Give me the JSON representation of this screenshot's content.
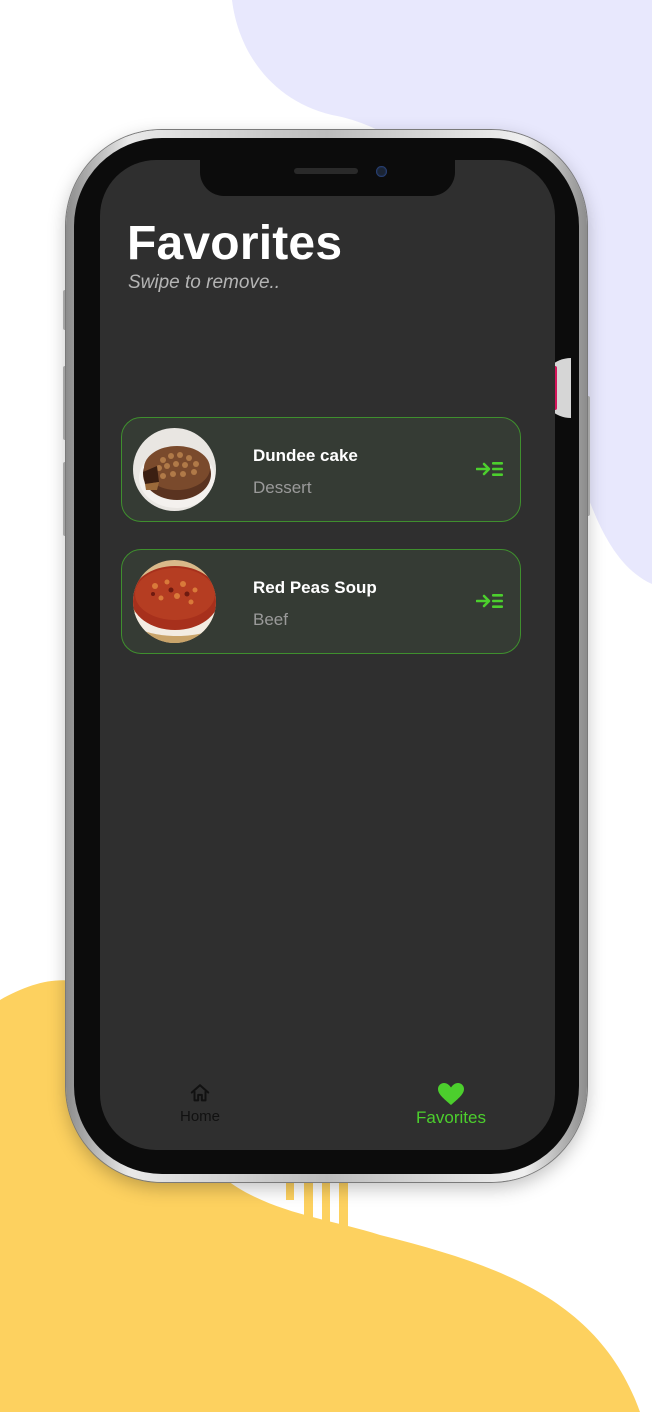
{
  "colors": {
    "accent": "#4ccf2d",
    "card_border": "#3f8f2e",
    "screen_bg": "#2f2f2f",
    "card_bg": "#353b34",
    "bg_purple": "#e8e8fd",
    "bg_yellow": "#fdd15f"
  },
  "header": {
    "title": "Favorites",
    "subtitle": "Swipe to remove.."
  },
  "favorites": [
    {
      "name": "Dundee cake",
      "category": "Dessert",
      "image_icon": "dundee-cake-photo",
      "action_icon": "add-to-list-icon"
    },
    {
      "name": "Red Peas Soup",
      "category": "Beef",
      "image_icon": "red-peas-soup-photo",
      "action_icon": "add-to-list-icon"
    }
  ],
  "nav": {
    "home": {
      "label": "Home",
      "icon": "home-icon"
    },
    "favorites": {
      "label": "Favorites",
      "icon": "heart-icon",
      "active": true
    }
  }
}
